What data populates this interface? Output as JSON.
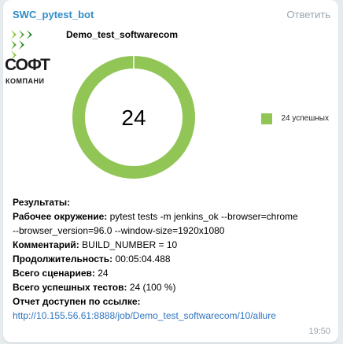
{
  "message": {
    "sender": "SWC_pytest_bot",
    "reply_label": "Ответить",
    "time": "19:50"
  },
  "logo": {
    "line1": "СОФТ",
    "line2": "КОМПАНИ"
  },
  "chart_data": {
    "type": "pie",
    "title": "Demo_test_softwarecom",
    "center_label": "24",
    "series": [
      {
        "name": "24 успешных",
        "value": 24,
        "color": "#91c656"
      }
    ],
    "legend_position": "right"
  },
  "report": {
    "heading": "Результаты:",
    "env_label": "Рабочее окружение:",
    "env_value_1": " pytest tests -m jenkins_ok --browser=chrome",
    "env_value_2": "--browser_version=96.0 --window-size=1920x1080",
    "comment_label": "Комментарий:",
    "comment_value": " BUILD_NUMBER = 10",
    "duration_label": "Продолжительность:",
    "duration_value": " 00:05:04.488",
    "scenarios_label": "Всего сценариев:",
    "scenarios_value": " 24",
    "passed_label": "Всего успешных тестов:",
    "passed_value": " 24 (100 %)",
    "link_label": "Отчет доступен по ссылке:",
    "link_url": "http://10.155.56.61:8888/job/Demo_test_softwarecom/10/allure"
  },
  "colors": {
    "accent": "#2f8cc7",
    "donut": "#91c656",
    "link": "#2f74c0"
  }
}
